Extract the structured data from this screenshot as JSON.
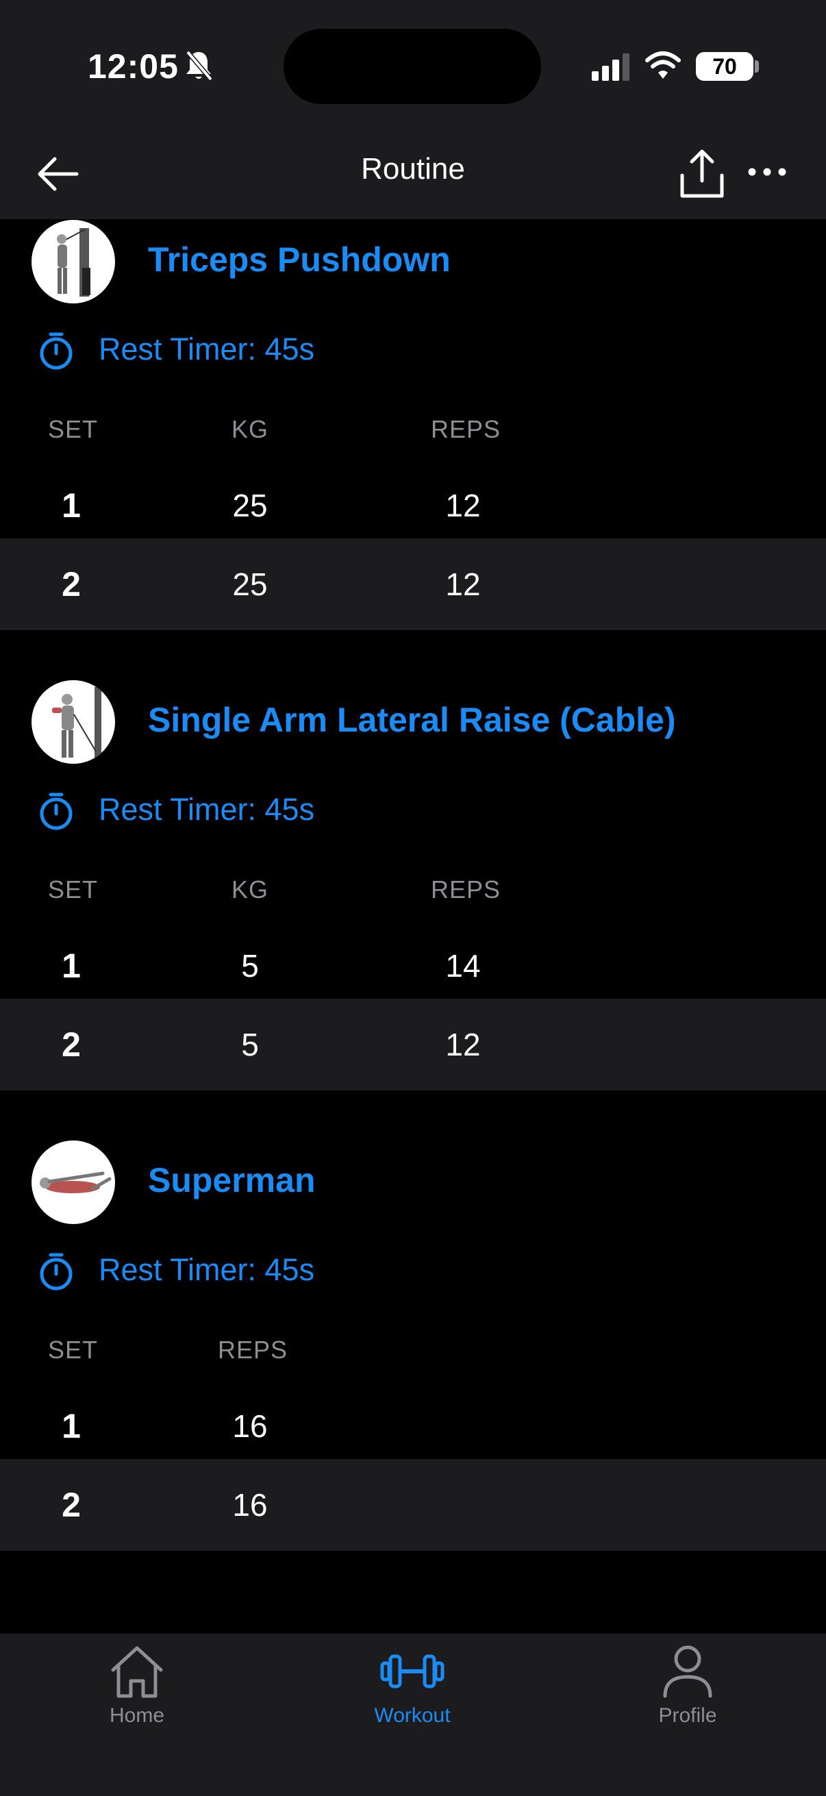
{
  "status": {
    "time": "12:05",
    "battery": "70"
  },
  "nav": {
    "title": "Routine"
  },
  "exercises": [
    {
      "name": "Triceps Pushdown",
      "rest": "Rest Timer: 45s",
      "headers": [
        "SET",
        "KG",
        "REPS"
      ],
      "rows": [
        [
          "1",
          "25",
          "12"
        ],
        [
          "2",
          "25",
          "12"
        ]
      ]
    },
    {
      "name": "Single Arm Lateral Raise (Cable)",
      "rest": "Rest Timer: 45s",
      "headers": [
        "SET",
        "KG",
        "REPS"
      ],
      "rows": [
        [
          "1",
          "5",
          "14"
        ],
        [
          "2",
          "5",
          "12"
        ]
      ]
    },
    {
      "name": "Superman",
      "rest": "Rest Timer: 45s",
      "headers": [
        "SET",
        "REPS"
      ],
      "rows": [
        [
          "1",
          "16"
        ],
        [
          "2",
          "16"
        ]
      ]
    }
  ],
  "tabs": [
    {
      "label": "Home",
      "icon": "home-icon",
      "active": false
    },
    {
      "label": "Workout",
      "icon": "dumbbell-icon",
      "active": true
    },
    {
      "label": "Profile",
      "icon": "profile-icon",
      "active": false
    }
  ],
  "colors": {
    "accent": "#1b8cf5",
    "bar": "#1c1c1e",
    "muted": "#8e8e93",
    "background": "#000000"
  }
}
